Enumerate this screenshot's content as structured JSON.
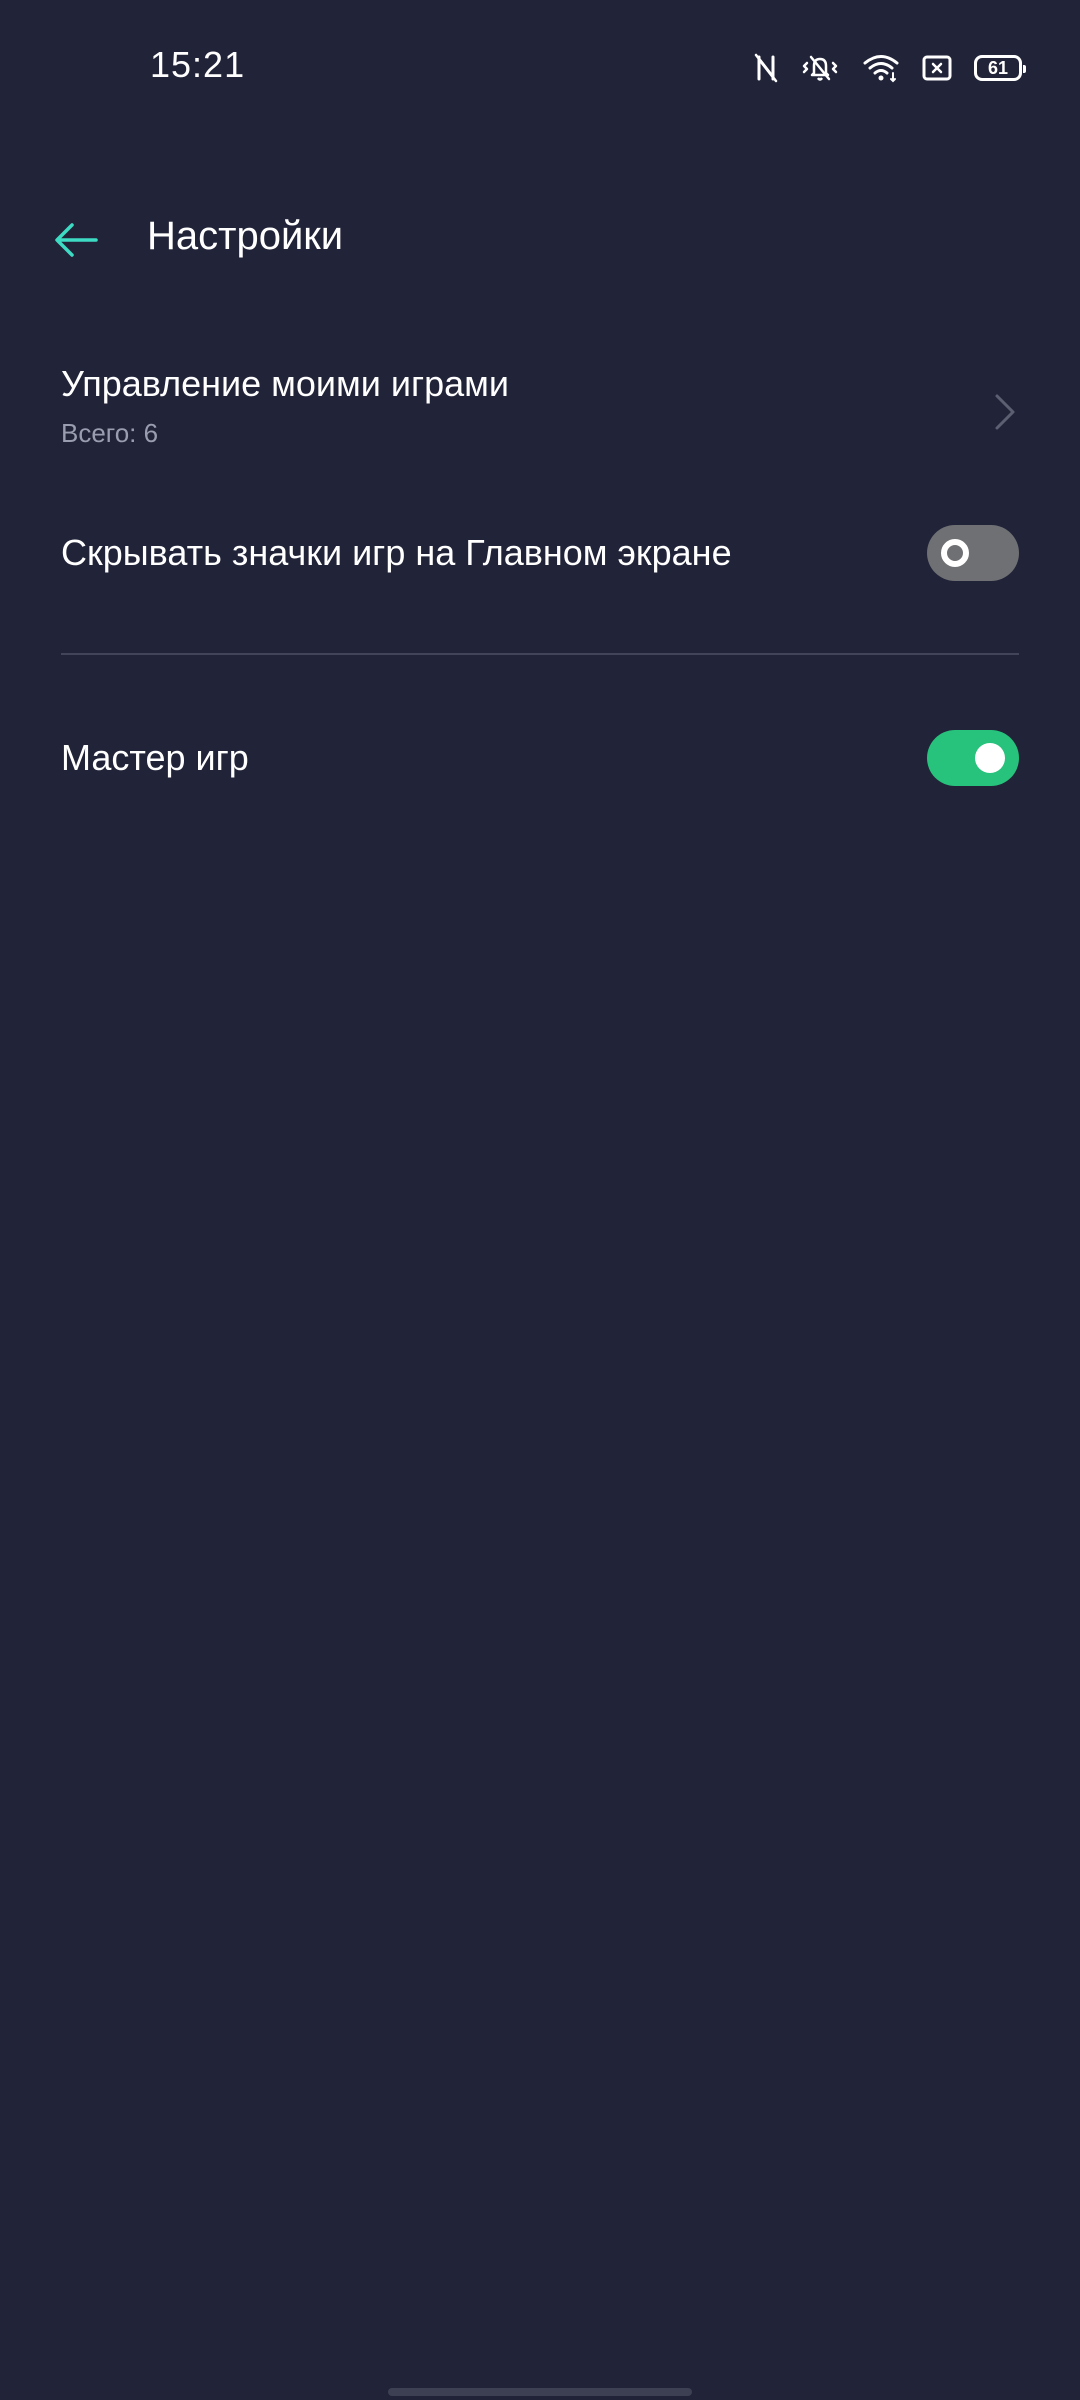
{
  "status_bar": {
    "time": "15:21",
    "battery_level": "61",
    "icons": [
      "nfc-off-icon",
      "vibrate-icon",
      "wifi-icon",
      "close-box-icon",
      "battery-icon"
    ]
  },
  "header": {
    "back_icon": "arrow-left-icon",
    "title": "Настройки"
  },
  "settings": {
    "manage_games": {
      "title": "Управление моими играми",
      "subtitle": "Всего: 6",
      "icon": "chevron-right-icon"
    },
    "hide_icons": {
      "title": "Скрывать значки игр на Главном экране",
      "enabled": false
    },
    "game_master": {
      "title": "Мастер игр",
      "enabled": true
    }
  },
  "colors": {
    "background": "#212338",
    "accent": "#3ddbc3",
    "toggle_on": "#27c27b",
    "toggle_off": "#6f7073",
    "secondary_text": "#9a9caf"
  }
}
